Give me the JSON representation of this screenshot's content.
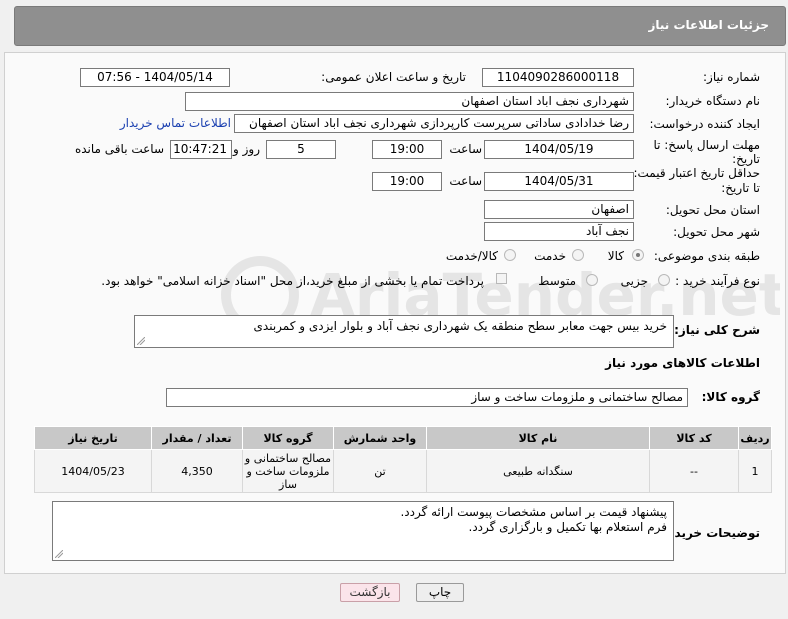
{
  "page_title": "جزئیات اطلاعات نیاز",
  "fields": {
    "need_number_label": "شماره نیاز:",
    "need_number": "1104090286000118",
    "announce_label": "تاریخ و ساعت اعلان عمومی:",
    "announce_value": "1404/05/14 - 07:56",
    "buyer_org_label": "نام دستگاه خریدار:",
    "buyer_org": "شهرداری نجف اباد استان اصفهان",
    "creator_label": "ایجاد کننده درخواست:",
    "creator": "رضا خدادادی ساداتی سرپرست  کارپردازی شهرداری نجف اباد استان اصفهان",
    "contact_link": "اطلاعات تماس خریدار",
    "deadline_label_1": "مهلت ارسال پاسخ: تا",
    "deadline_label_2": "تاریخ:",
    "deadline_date": "1404/05/19",
    "time_label": "ساعت",
    "deadline_time": "19:00",
    "days_value": "5",
    "days_label": "روز و",
    "remaining_time": "10:47:21",
    "remaining_label": "ساعت باقی مانده",
    "validity_label_1": "حداقل تاریخ اعتبار قیمت:",
    "validity_label_2": "تا تاریخ:",
    "validity_date": "1404/05/31",
    "validity_time": "19:00",
    "province_label": "استان محل تحویل:",
    "province": "اصفهان",
    "city_label": "شهر محل تحویل:",
    "city": "نجف آباد",
    "category_label": "طبقه بندی موضوعی:",
    "category_options": [
      "کالا",
      "خدمت",
      "کالا/خدمت"
    ],
    "process_label": "نوع فرآیند خرید :",
    "process_options": [
      "جزیی",
      "متوسط"
    ],
    "payment_note": "پرداخت تمام یا بخشی از مبلغ خرید،از محل \"اسناد خزانه اسلامی\" خواهد بود.",
    "description_label": "شرح کلی نیاز:",
    "description": "خرید بیس جهت معابر سطح منطقه یک شهرداری نجف آباد و بلوار ایزدی و کمربندی",
    "goods_info_title": "اطلاعات کالاهای مورد نیاز",
    "goods_group_label": "گروه کالا:",
    "goods_group": "مصالح ساختمانی و ملزومات ساخت و ساز",
    "buyer_notes_label": "توضیحات خریدار:",
    "buyer_notes_1": "پیشنهاد قیمت بر اساس مشخصات پیوست ارائه گردد.",
    "buyer_notes_2": "فرم استعلام بها تکمیل و بارگزاری گردد."
  },
  "table": {
    "headers": [
      "ردیف",
      "کد کالا",
      "نام کالا",
      "واحد شمارش",
      "گروه کالا",
      "تعداد / مقدار",
      "تاریخ نیاز"
    ],
    "rows": [
      [
        "1",
        "--",
        "سنگدانه طبیعی",
        "تن",
        "مصالح ساختمانی و ملزومات ساخت و ساز",
        "4,350",
        "1404/05/23"
      ]
    ]
  },
  "buttons": {
    "print": "چاپ",
    "back": "بازگشت"
  },
  "watermark": "AriaTender.net"
}
